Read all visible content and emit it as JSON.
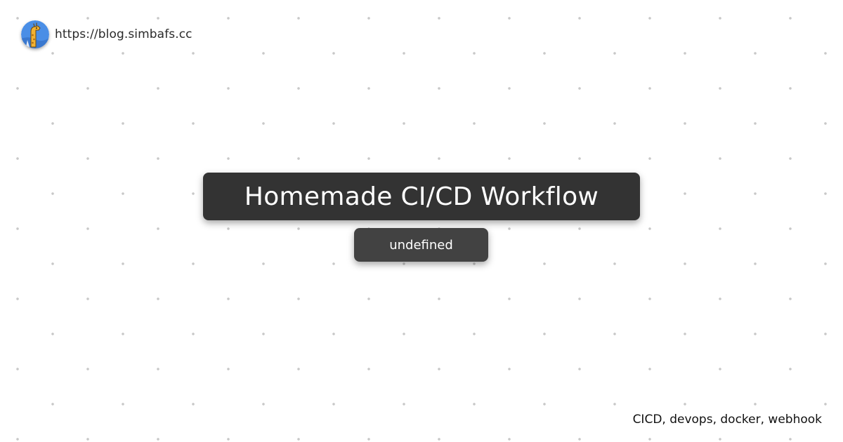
{
  "header": {
    "site_url": "https://blog.simbafs.cc",
    "avatar_icon": "giraffe-avatar-icon"
  },
  "post": {
    "title": "Homemade CI/CD Workflow",
    "subtitle": "undefined",
    "tags": "CICD, devops, docker, webhook"
  },
  "colors": {
    "background": "#ffffff",
    "dot": "#c8c8c8",
    "title_box": "#333333",
    "subtitle_box": "#424242",
    "box_text": "#ffffff",
    "avatar_background": "#4a8ee6",
    "avatar_figure": "#f2b232"
  }
}
